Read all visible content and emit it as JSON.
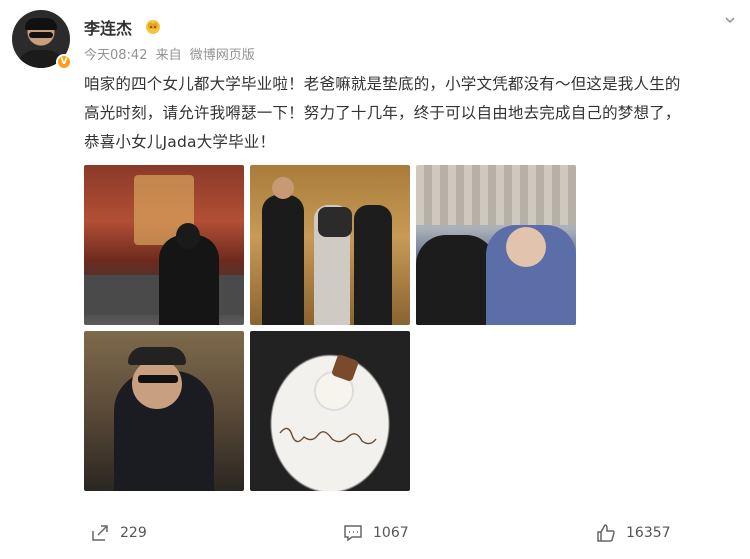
{
  "user": {
    "name": "李连杰",
    "verified_badge": "V",
    "crown_icon": "crown-icon"
  },
  "meta": {
    "time": "今天08:42",
    "source_prefix": "来自",
    "source": "微博网页版"
  },
  "post": {
    "text_line1": "咱家的四个女儿都大学毕业啦！老爸嘛就是垫底的，小学文凭都没有～但这是我人生的",
    "text_line2": "高光时刻，请允许我嘚瑟一下！努力了十几年，终于可以自由地去完成自己的梦想了，",
    "text_line3": "恭喜小女儿Jada大学毕业！"
  },
  "photos": [
    {
      "alt": "theater-hall-photo"
    },
    {
      "alt": "family-with-flowers-photo"
    },
    {
      "alt": "selfie-at-ceremony-photo"
    },
    {
      "alt": "man-in-cap-restaurant-photo"
    },
    {
      "alt": "congratulations-dessert-plate-photo"
    }
  ],
  "actions": {
    "repost_count": "229",
    "comment_count": "1067",
    "like_count": "16357"
  },
  "colors": {
    "text": "#333333",
    "meta": "#939393",
    "badge": "#f7a11a"
  }
}
